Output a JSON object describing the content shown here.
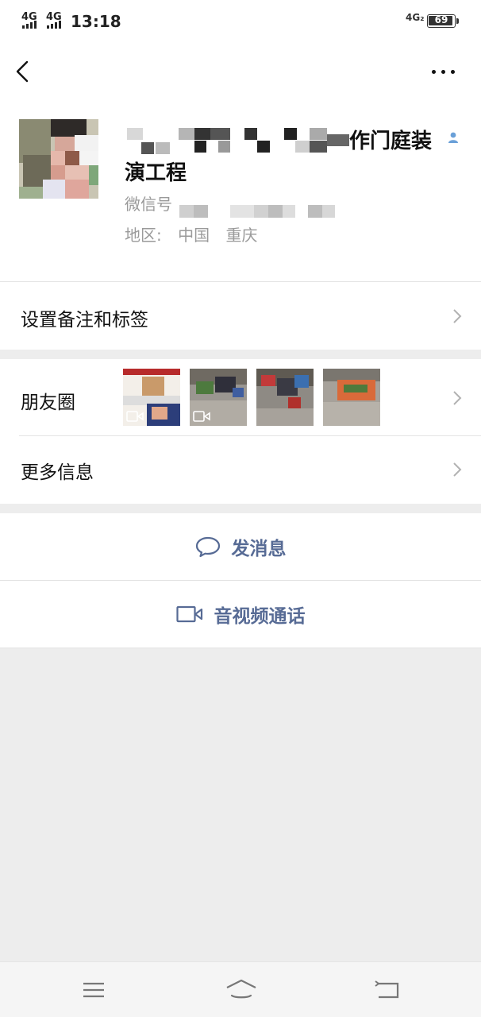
{
  "status_bar": {
    "signal_1": "4G",
    "signal_2": "4G",
    "time": "13:18",
    "network": "4G₂",
    "battery": "69"
  },
  "profile": {
    "nickname_visible_part": "门作门庭装",
    "nickname_line2": "演工程",
    "wechat_id_label": "微信号",
    "region_label": "地区:",
    "region_country": "中国",
    "region_city": "重庆"
  },
  "menu": {
    "remark_tags": "设置备注和标签",
    "moments": "朋友圈",
    "more_info": "更多信息"
  },
  "moments_thumbs": [
    {
      "name": "moment-photo-1",
      "video": true
    },
    {
      "name": "moment-photo-2",
      "video": true
    },
    {
      "name": "moment-photo-3",
      "video": false
    },
    {
      "name": "moment-photo-4",
      "video": false
    }
  ],
  "actions": {
    "send_message": "发消息",
    "video_call": "音视频通话"
  },
  "icons": {
    "back": "chevron-left-icon",
    "more": "more-dots-icon",
    "verified": "person-verified-icon",
    "message": "chat-bubble-icon",
    "video": "video-camera-icon",
    "nav_menu": "menu-icon",
    "nav_home": "home-icon",
    "nav_back": "return-icon"
  },
  "colors": {
    "link_blue": "#576b95",
    "background": "#ededed",
    "secondary_text": "#9a9a9a"
  }
}
